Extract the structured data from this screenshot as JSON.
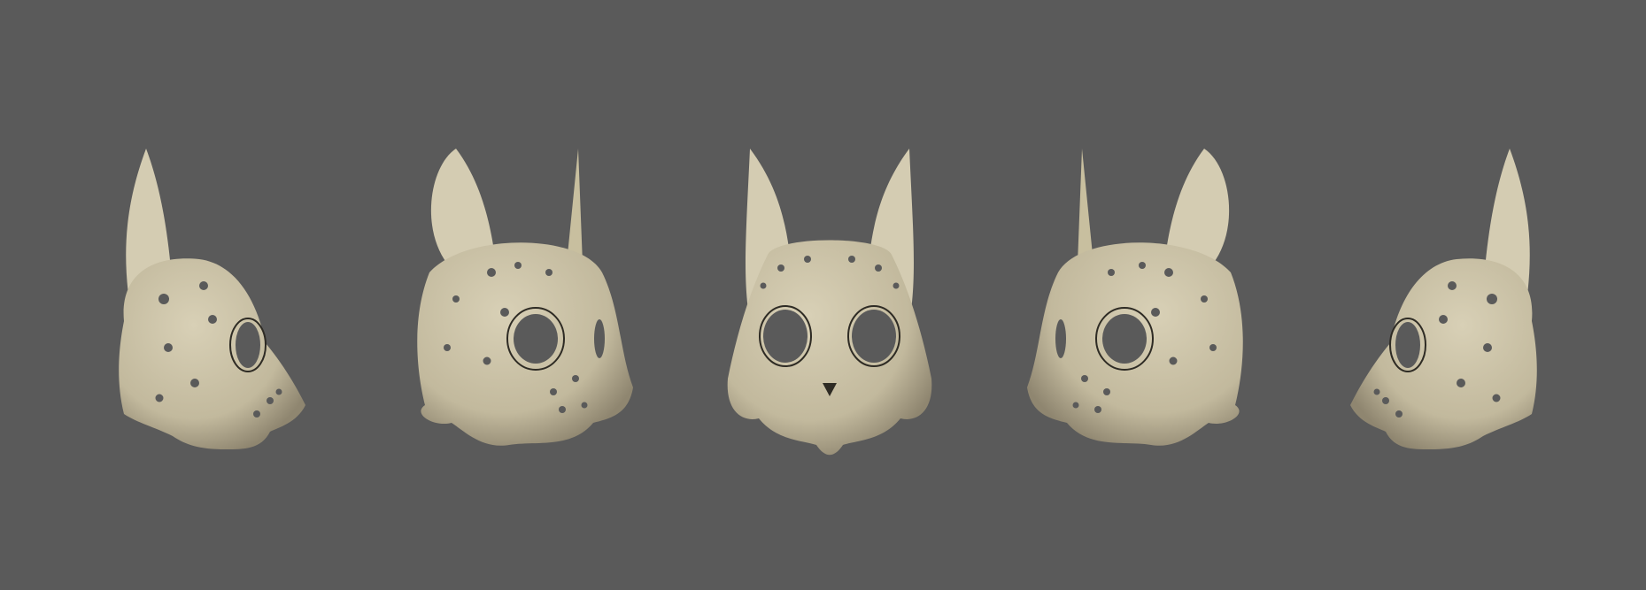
{
  "scene": {
    "views": [
      "left-profile",
      "left-three-quarter",
      "front",
      "right-three-quarter",
      "right-profile"
    ],
    "colors": {
      "background": "#5a5a5a",
      "mask": "#cbc3a8",
      "mask_shadow": "#8f8670",
      "ear": "#d4ccb2"
    }
  }
}
